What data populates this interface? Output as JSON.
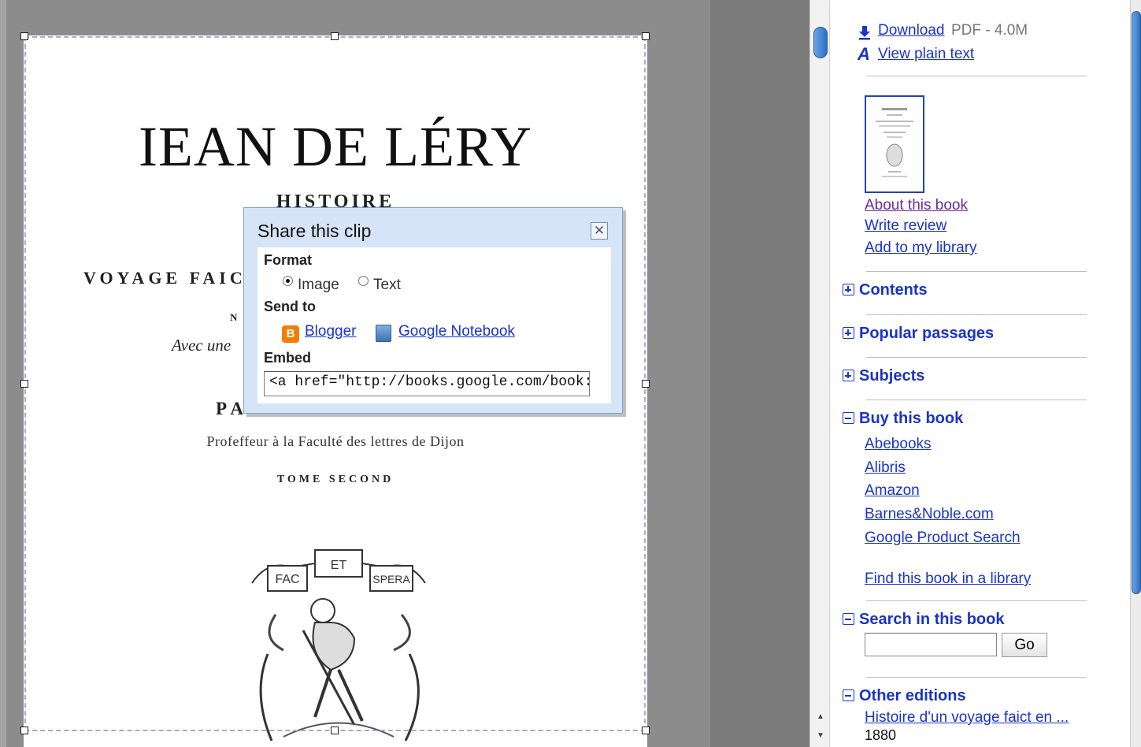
{
  "book_page": {
    "title": "IEAN DE LÉRY",
    "line_histoire": "HISTOIRE",
    "line_voyage": "VOYAGE FAIC",
    "line_n": "N",
    "line_avec": "Avec une",
    "line_paul": "PA",
    "line_prof": "Profeffeur à la Faculté des lettres de Dijon",
    "line_tome": "TOME SECOND",
    "emblem_banner_left": "FAC",
    "emblem_banner_mid": "ET",
    "emblem_banner_right": "SPERA"
  },
  "share_dialog": {
    "title": "Share this clip",
    "format_label": "Format",
    "format_options": [
      "Image",
      "Text"
    ],
    "format_selected": "Image",
    "send_to_label": "Send to",
    "send_targets": [
      "Blogger",
      "Google Notebook"
    ],
    "embed_label": "Embed",
    "embed_value": "<a href=\"http://books.google.com/book:"
  },
  "sidebar": {
    "download_label": "Download",
    "download_info": "PDF - 4.0M",
    "plain_text_label": "View plain text",
    "about_label": "About this book",
    "review_label": "Write review",
    "library_label": "Add to my library",
    "sections": {
      "contents": "Contents",
      "popular": "Popular passages",
      "subjects": "Subjects",
      "buy": "Buy this book",
      "search": "Search in this book",
      "editions": "Other editions"
    },
    "buy_links": [
      "Abebooks",
      "Alibris",
      "Amazon",
      "Barnes&Noble.com",
      "Google Product Search"
    ],
    "find_library": "Find this book in a library",
    "go_label": "Go",
    "edition_title": "Histoire d'un voyage faict en ...",
    "edition_year": "1880"
  },
  "colors": {
    "link": "#1a33c9",
    "visited": "#6b2a99",
    "dialog_bg": "#d6e4f8"
  },
  "icons": [
    "download-icon",
    "text-icon",
    "blogger-icon",
    "notebook-icon",
    "close-icon",
    "plus-box-icon",
    "minus-box-icon"
  ]
}
